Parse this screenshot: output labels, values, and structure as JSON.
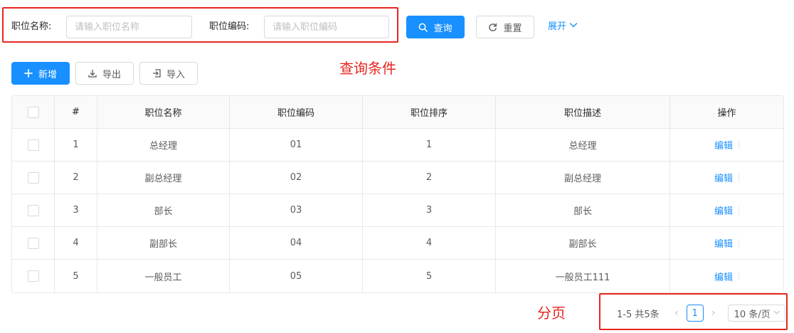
{
  "search": {
    "name_label": "职位名称:",
    "name_placeholder": "请输入职位名称",
    "code_label": "职位编码:",
    "code_placeholder": "请输入职位编码",
    "query_label": "查询",
    "reset_label": "重置",
    "expand_label": "展开"
  },
  "toolbar": {
    "add_label": "新增",
    "export_label": "导出",
    "import_label": "导入"
  },
  "annotations": {
    "query_conditions": "查询条件",
    "pagination": "分页"
  },
  "table": {
    "headers": [
      "#",
      "职位名称",
      "职位编码",
      "职位排序",
      "职位描述",
      "操作"
    ],
    "rows": [
      {
        "index": "1",
        "name": "总经理",
        "code": "01",
        "order": "1",
        "desc": "总经理",
        "action": "编辑"
      },
      {
        "index": "2",
        "name": "副总经理",
        "code": "02",
        "order": "2",
        "desc": "副总经理",
        "action": "编辑"
      },
      {
        "index": "3",
        "name": "部长",
        "code": "03",
        "order": "3",
        "desc": "部长",
        "action": "编辑"
      },
      {
        "index": "4",
        "name": "副部长",
        "code": "04",
        "order": "4",
        "desc": "副部长",
        "action": "编辑"
      },
      {
        "index": "5",
        "name": "一般员工",
        "code": "05",
        "order": "5",
        "desc": "一般员工111",
        "action": "编辑"
      }
    ]
  },
  "pagination": {
    "total_text": "1-5 共5条",
    "current_page": "1",
    "page_size": "10 条/页"
  },
  "colors": {
    "primary": "#1890ff",
    "annotation": "#e8261f"
  }
}
